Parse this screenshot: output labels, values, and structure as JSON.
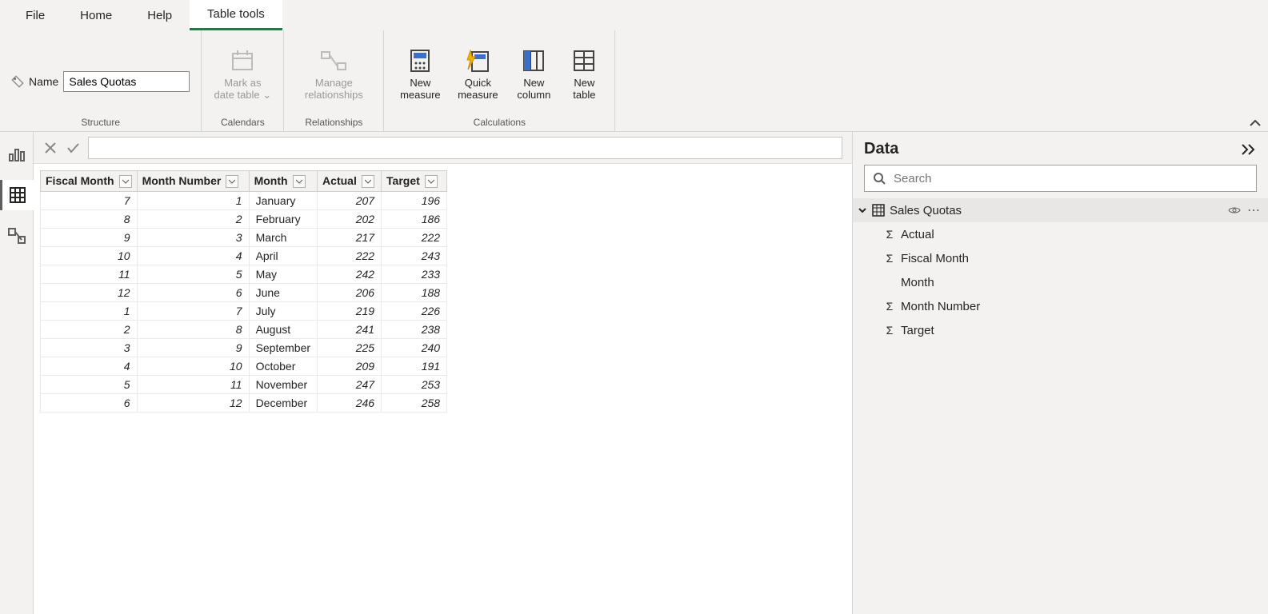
{
  "tabs": {
    "file": "File",
    "home": "Home",
    "help": "Help",
    "tabletools": "Table tools"
  },
  "structure": {
    "name_label": "Name",
    "name_value": "Sales Quotas",
    "group_label": "Structure"
  },
  "calendars": {
    "btn": "Mark as date table",
    "group_label": "Calendars"
  },
  "relationships": {
    "btn": "Manage relationships",
    "group_label": "Relationships"
  },
  "calcs": {
    "newmeasure": "New measure",
    "quickmeasure": "Quick measure",
    "newcolumn": "New column",
    "newtable": "New table",
    "group_label": "Calculations"
  },
  "datapane": {
    "title": "Data",
    "search_placeholder": "Search"
  },
  "tree_table": "Sales Quotas",
  "fields": {
    "actual": "Actual",
    "fiscalmonth": "Fiscal Month",
    "month": "Month",
    "monthnumber": "Month Number",
    "target": "Target"
  },
  "columns": {
    "fiscalmonth": "Fiscal Month",
    "monthnumber": "Month Number",
    "month": "Month",
    "actual": "Actual",
    "target": "Target"
  },
  "rows": [
    {
      "fiscalmonth": 7,
      "monthnumber": 1,
      "month": "January",
      "actual": 207,
      "target": 196
    },
    {
      "fiscalmonth": 8,
      "monthnumber": 2,
      "month": "February",
      "actual": 202,
      "target": 186
    },
    {
      "fiscalmonth": 9,
      "monthnumber": 3,
      "month": "March",
      "actual": 217,
      "target": 222
    },
    {
      "fiscalmonth": 10,
      "monthnumber": 4,
      "month": "April",
      "actual": 222,
      "target": 243
    },
    {
      "fiscalmonth": 11,
      "monthnumber": 5,
      "month": "May",
      "actual": 242,
      "target": 233
    },
    {
      "fiscalmonth": 12,
      "monthnumber": 6,
      "month": "June",
      "actual": 206,
      "target": 188
    },
    {
      "fiscalmonth": 1,
      "monthnumber": 7,
      "month": "July",
      "actual": 219,
      "target": 226
    },
    {
      "fiscalmonth": 2,
      "monthnumber": 8,
      "month": "August",
      "actual": 241,
      "target": 238
    },
    {
      "fiscalmonth": 3,
      "monthnumber": 9,
      "month": "September",
      "actual": 225,
      "target": 240
    },
    {
      "fiscalmonth": 4,
      "monthnumber": 10,
      "month": "October",
      "actual": 209,
      "target": 191
    },
    {
      "fiscalmonth": 5,
      "monthnumber": 11,
      "month": "November",
      "actual": 247,
      "target": 253
    },
    {
      "fiscalmonth": 6,
      "monthnumber": 12,
      "month": "December",
      "actual": 246,
      "target": 258
    }
  ]
}
